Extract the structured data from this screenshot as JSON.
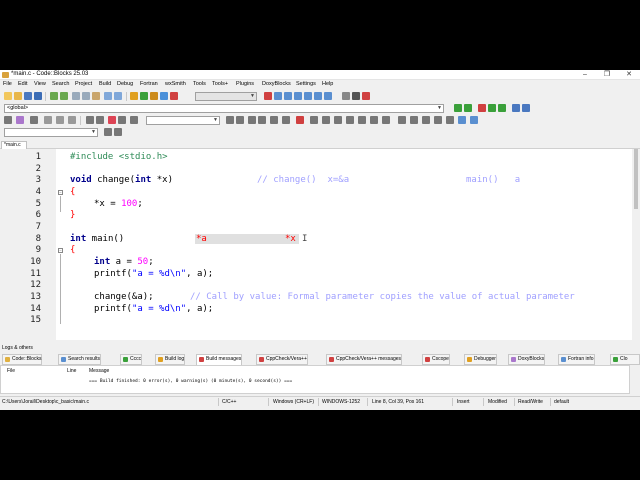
{
  "window": {
    "title": "*main.c - Code::Blocks 25.03",
    "minimize": "–",
    "maximize": "❐",
    "close": "✕"
  },
  "menu": [
    "File",
    "Edit",
    "View",
    "Search",
    "Project",
    "Build",
    "Debug",
    "Fortran",
    "wxSmith",
    "Tools",
    "Tools+",
    "Plugins",
    "DoxyBlocks",
    "Settings",
    "Help"
  ],
  "toolbar": {
    "scope_select": "<global>",
    "search_select": ""
  },
  "editor": {
    "tab_label": "*main.c",
    "lines": [
      "1",
      "2",
      "3",
      "4",
      "5",
      "6",
      "7",
      "8",
      "9",
      "10",
      "11",
      "12",
      "13",
      "14",
      "15"
    ],
    "code": {
      "l1_pp": "#include <stdio.h>",
      "l3_kw_void": "void",
      "l3_name": " change(",
      "l3_kw_int": "int",
      "l3_rest": " *x)",
      "l3_comment": "// change()  x=&a",
      "l3_comment2": "main()   a",
      "l4_brace": "{",
      "l5_ptr": "*x = ",
      "l5_num": "100",
      "l5_end": ";",
      "l6_brace": "}",
      "l8_kw_int": "int",
      "l8_rest": " main()",
      "l8_anno1": "*a",
      "l8_anno2": "*x",
      "l9_brace": "{",
      "l10_kw_int": "int",
      "l10_rest": " a = ",
      "l10_num": "50",
      "l10_end": ";",
      "l11_pre": "printf(",
      "l11_str": "\"a = %d\\n\"",
      "l11_post": ", a);",
      "l13_code": "change(&a);",
      "l13_comment": "// Call by value: Formal parameter copies the value of actual parameter",
      "l14_pre": "printf(",
      "l14_str": "\"a = %d\\n\"",
      "l14_post": ", a);"
    }
  },
  "logs": {
    "title": "Logs & others",
    "tabs": [
      "Code::Blocks",
      "Search results",
      "Cccc",
      "Build log",
      "Build messages",
      "CppCheck/Vera++",
      "CppCheck/Vera++ messages",
      "Cscope",
      "Debugger",
      "DoxyBlocks",
      "Fortran info",
      "Clo"
    ],
    "columns": [
      "File",
      "Line",
      "Message"
    ],
    "message": "=== Build finished: 0 error(s), 0 warning(s) (0 minute(s), 0 second(s)) ==="
  },
  "status": {
    "path": "C:\\Users\\Jorail\\Desktop\\c_basic\\main.c",
    "language": "C/C++",
    "line_endings": "Windows (CR+LF)",
    "encoding": "WINDOWS-1252",
    "position": "Line 8, Col 39, Pos 161",
    "mode": "Insert",
    "modified": "Modified",
    "access": "Read/Write",
    "profile": "default"
  },
  "colors": {
    "keyword": "#00008b",
    "preprocessor": "#2e8b57",
    "number": "#ff00ff",
    "string": "#0000ff",
    "comment": "#a0a0ff",
    "operator": "#ff0000"
  }
}
